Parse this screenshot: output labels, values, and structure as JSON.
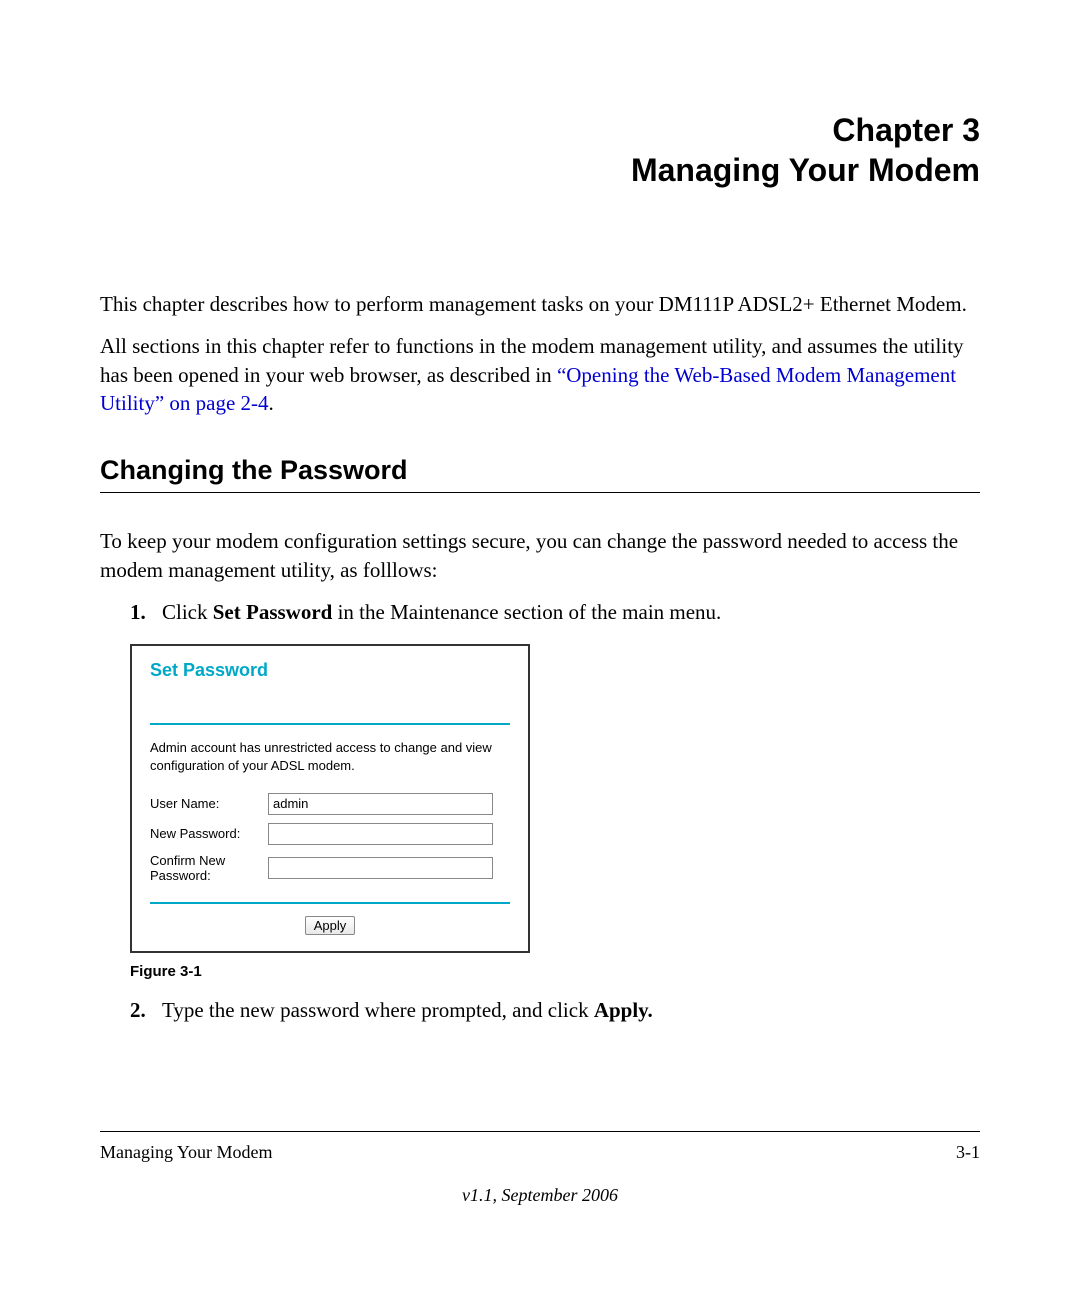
{
  "chapter": {
    "number": "Chapter 3",
    "name": "Managing Your Modem"
  },
  "intro": {
    "p1": "This chapter describes how to perform management tasks on your DM111P ADSL2+ Ethernet Modem.",
    "p2_a": "All sections in this chapter refer to functions in the modem management utility, and assumes the utility has been opened in your web browser, as described in ",
    "p2_link": "“Opening the Web-Based Modem Management Utility” on page 2-4",
    "p2_b": "."
  },
  "section": {
    "heading": "Changing the Password",
    "p": "To keep your modem configuration settings secure, you can change the password needed to access the modem management utility, as folllows:"
  },
  "steps": {
    "s1": {
      "num": "1.",
      "a": "Click ",
      "bold": "Set Password",
      "b": " in the Maintenance section of the main menu."
    },
    "s2": {
      "num": "2.",
      "a": "Type the new password where prompted, and click ",
      "bold": "Apply."
    }
  },
  "figure": {
    "title": "Set Password",
    "desc": "Admin account has unrestricted access to change and view configuration of your ADSL modem.",
    "labels": {
      "username": "User Name:",
      "newpassword": "New Password:",
      "confirm": "Confirm New Password:"
    },
    "values": {
      "username": "admin",
      "newpassword": "",
      "confirm": ""
    },
    "apply": "Apply",
    "caption": "Figure 3-1"
  },
  "footer": {
    "left": "Managing Your Modem",
    "right": "3-1",
    "version": "v1.1, September 2006"
  }
}
